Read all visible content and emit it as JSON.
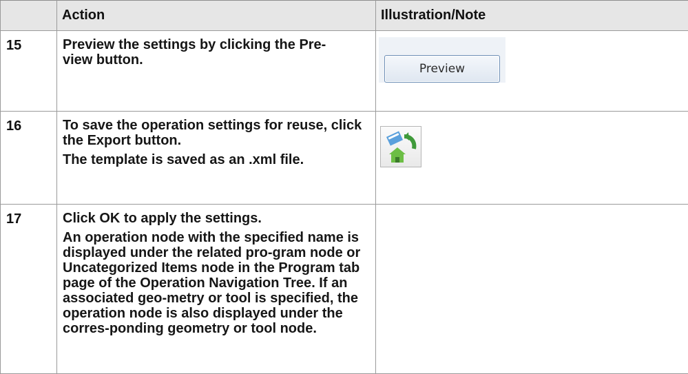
{
  "header": {
    "col_step": "",
    "col_action": "Action",
    "col_illustration": "Illustration/Note"
  },
  "rows": [
    {
      "step": "15",
      "action_lines": [
        "Preview the settings by clicking the ",
        "Pre-",
        "view",
        " button."
      ],
      "illustration": {
        "type": "button",
        "label": "Preview"
      }
    },
    {
      "step": "16",
      "para1": [
        "To save the operation settings for reuse, click the ",
        "Export",
        " button."
      ],
      "para2": "The template is saved as an .xml file.",
      "illustration": {
        "type": "icon",
        "icon": "export-icon"
      }
    },
    {
      "step": "17",
      "para1": [
        "Click ",
        "OK",
        " to apply the settings."
      ],
      "para2": [
        "An operation node with the specified name is displayed under the related pro-gram node or ",
        "Uncategorized Items",
        " node in the ",
        "Program",
        " tab page of the ",
        "Operation Navigation Tree",
        ". If an associated geo-metry or tool is specified, the operation node is also displayed under the corres-ponding geometry or tool node."
      ]
    }
  ],
  "colors": {
    "header_bg": "#e6e6e6",
    "border": "#9a9a9a",
    "button_border": "#6e8fb6"
  }
}
